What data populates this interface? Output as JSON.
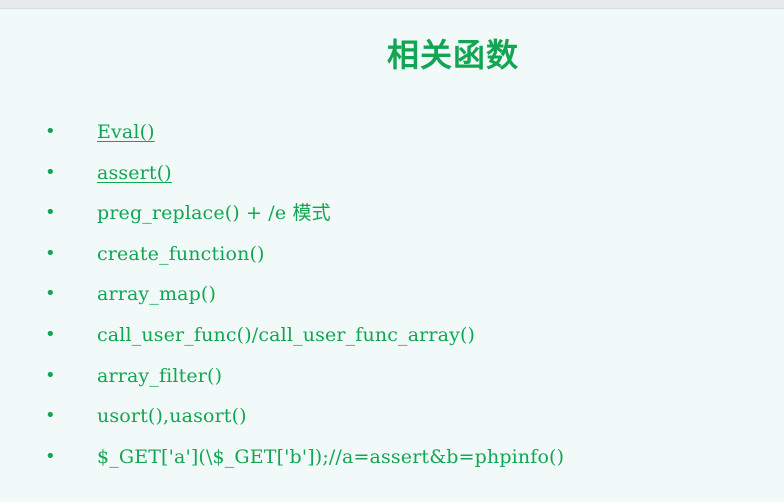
{
  "slide": {
    "title": "相关函数",
    "items": [
      {
        "text": "Eval()",
        "link": true
      },
      {
        "text": "assert()",
        "link": true
      },
      {
        "text": "preg_replace() + /e 模式",
        "link": false
      },
      {
        "text": "create_function()",
        "link": false
      },
      {
        "text": "array_map()",
        "link": false
      },
      {
        "text": "call_user_func()/call_user_func_array()",
        "link": false
      },
      {
        "text": "array_filter()",
        "link": false
      },
      {
        "text": "usort(),uasort()",
        "link": false
      },
      {
        "text": "$_GET['a'](\\$_GET['b']);//a=assert&b=phpinfo()",
        "link": false
      }
    ],
    "bullet": "•",
    "colors": {
      "accent": "#12a552",
      "background": "#f1faf9"
    }
  }
}
